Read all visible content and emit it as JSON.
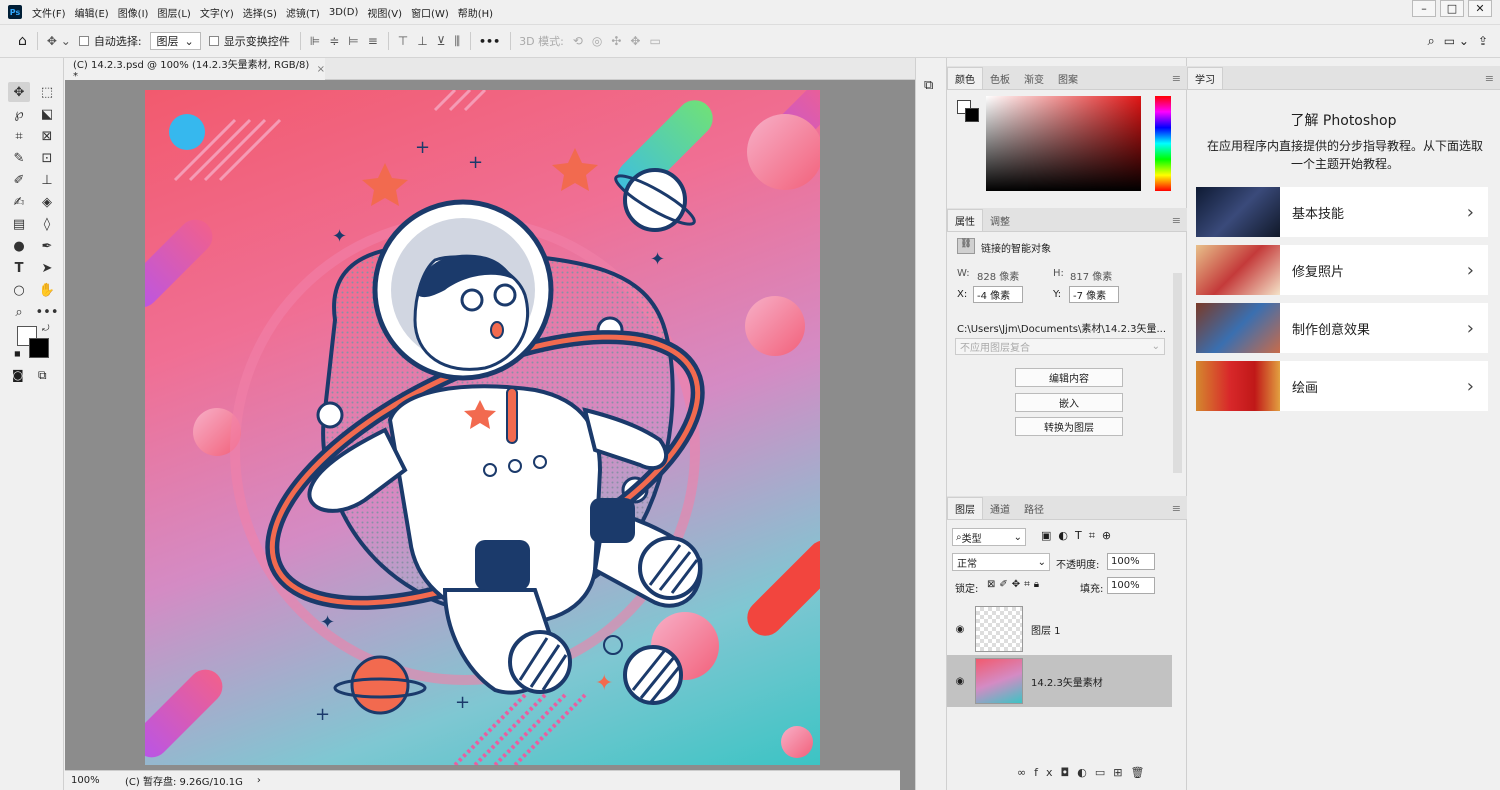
{
  "menubar": {
    "app_badge": "Ps",
    "items": [
      "文件(F)",
      "编辑(E)",
      "图像(I)",
      "图层(L)",
      "文字(Y)",
      "选择(S)",
      "滤镜(T)",
      "3D(D)",
      "视图(V)",
      "窗口(W)",
      "帮助(H)"
    ]
  },
  "optionsbar": {
    "auto_select_label": "自动选择:",
    "auto_select_value": "图层",
    "show_transform_label": "显示变换控件",
    "more": "•••",
    "mode_3d_label": "3D 模式:"
  },
  "document": {
    "tab_title": "(C) 14.2.3.psd @ 100% (14.2.3矢量素材, RGB/8) *",
    "zoom": "100%",
    "scratch": "(C) 暂存盘: 9.26G/10.1G"
  },
  "color_panel": {
    "tabs": [
      "颜色",
      "色板",
      "渐变",
      "图案"
    ]
  },
  "properties_panel": {
    "tabs": [
      "属性",
      "调整"
    ],
    "object_type": "链接的智能对象",
    "w_label": "W:",
    "w_value": "828 像素",
    "h_label": "H:",
    "h_value": "817 像素",
    "x_label": "X:",
    "x_value": "-4 像素",
    "y_label": "Y:",
    "y_value": "-7 像素",
    "path": "C:\\Users\\Jjm\\Documents\\素材\\14.2.3矢量...",
    "comp_placeholder": "不应用图层复合",
    "btn_edit": "编辑内容",
    "btn_embed": "嵌入",
    "btn_convert": "转换为图层"
  },
  "layers_panel": {
    "tabs": [
      "图层",
      "通道",
      "路径"
    ],
    "filter_label": "类型",
    "blend_mode": "正常",
    "opacity_label": "不透明度:",
    "opacity_value": "100%",
    "lock_label": "锁定:",
    "fill_label": "填充:",
    "fill_value": "100%",
    "layers": [
      {
        "name": "图层 1"
      },
      {
        "name": "14.2.3矢量素材",
        "selected": true
      }
    ]
  },
  "learn_panel": {
    "tab": "学习",
    "title": "了解 Photoshop",
    "subtitle": "在应用程序内直接提供的分步指导教程。从下面选取一个主题开始教程。",
    "items": [
      {
        "label": "基本技能"
      },
      {
        "label": "修复照片"
      },
      {
        "label": "制作创意效果"
      },
      {
        "label": "绘画"
      }
    ]
  },
  "colors": {
    "ps_badge_bg": "#001e36",
    "ps_badge_fg": "#31a8ff",
    "selected_layer_bg": "#c2c2c2",
    "navy": "#1b3a6b",
    "coral": "#f26a4f"
  }
}
